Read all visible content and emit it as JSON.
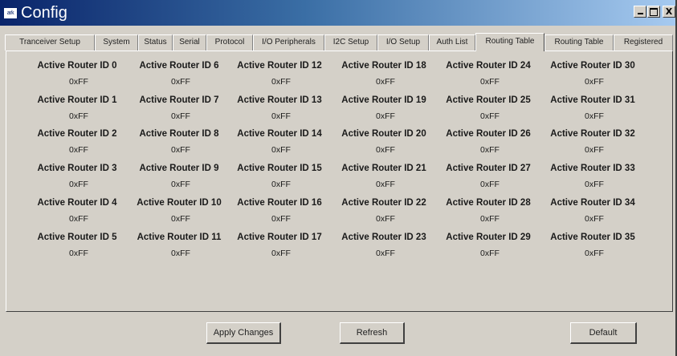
{
  "window": {
    "title": "Config",
    "icon_text": "ark",
    "controls": {
      "minimize": "_",
      "maximize": "□",
      "close": "X"
    }
  },
  "tabs": [
    {
      "label": "Tranceiver Setup"
    },
    {
      "label": "System"
    },
    {
      "label": "Status"
    },
    {
      "label": "Serial"
    },
    {
      "label": "Protocol"
    },
    {
      "label": "I/O Peripherals"
    },
    {
      "label": "I2C Setup"
    },
    {
      "label": "I/O Setup"
    },
    {
      "label": "Auth List"
    },
    {
      "label": "Routing Table",
      "active": true
    },
    {
      "label": "Routing Table"
    },
    {
      "label": "Registered"
    }
  ],
  "routers": [
    {
      "label": "Active Router ID 0",
      "value": "0xFF"
    },
    {
      "label": "Active Router ID 1",
      "value": "0xFF"
    },
    {
      "label": "Active Router ID 2",
      "value": "0xFF"
    },
    {
      "label": "Active Router ID 3",
      "value": "0xFF"
    },
    {
      "label": "Active Router ID 4",
      "value": "0xFF"
    },
    {
      "label": "Active Router ID 5",
      "value": "0xFF"
    },
    {
      "label": "Active Router ID 6",
      "value": "0xFF"
    },
    {
      "label": "Active Router ID 7",
      "value": "0xFF"
    },
    {
      "label": "Active Router ID 8",
      "value": "0xFF"
    },
    {
      "label": "Active Router ID 9",
      "value": "0xFF"
    },
    {
      "label": "Active Router ID 10",
      "value": "0xFF"
    },
    {
      "label": "Active Router ID 11",
      "value": "0xFF"
    },
    {
      "label": "Active Router ID 12",
      "value": "0xFF"
    },
    {
      "label": "Active Router ID 13",
      "value": "0xFF"
    },
    {
      "label": "Active Router ID 14",
      "value": "0xFF"
    },
    {
      "label": "Active Router ID 15",
      "value": "0xFF"
    },
    {
      "label": "Active Router ID 16",
      "value": "0xFF"
    },
    {
      "label": "Active Router ID 17",
      "value": "0xFF"
    },
    {
      "label": "Active Router ID 18",
      "value": "0xFF"
    },
    {
      "label": "Active Router ID 19",
      "value": "0xFF"
    },
    {
      "label": "Active Router ID 20",
      "value": "0xFF"
    },
    {
      "label": "Active Router ID 21",
      "value": "0xFF"
    },
    {
      "label": "Active Router ID 22",
      "value": "0xFF"
    },
    {
      "label": "Active Router ID 23",
      "value": "0xFF"
    },
    {
      "label": "Active Router ID 24",
      "value": "0xFF"
    },
    {
      "label": "Active Router ID 25",
      "value": "0xFF"
    },
    {
      "label": "Active Router ID 26",
      "value": "0xFF"
    },
    {
      "label": "Active Router ID 27",
      "value": "0xFF"
    },
    {
      "label": "Active Router ID 28",
      "value": "0xFF"
    },
    {
      "label": "Active Router ID 29",
      "value": "0xFF"
    },
    {
      "label": "Active Router ID 30",
      "value": "0xFF"
    },
    {
      "label": "Active Router ID 31",
      "value": "0xFF"
    },
    {
      "label": "Active Router ID 32",
      "value": "0xFF"
    },
    {
      "label": "Active Router ID 33",
      "value": "0xFF"
    },
    {
      "label": "Active Router ID 34",
      "value": "0xFF"
    },
    {
      "label": "Active Router ID 35",
      "value": "0xFF"
    }
  ],
  "buttons": {
    "apply": "Apply Changes",
    "refresh": "Refresh",
    "default": "Default"
  },
  "colors": {
    "titlebar_start": "#0a246a",
    "titlebar_end": "#a6caf0",
    "face": "#d4d0c8"
  }
}
